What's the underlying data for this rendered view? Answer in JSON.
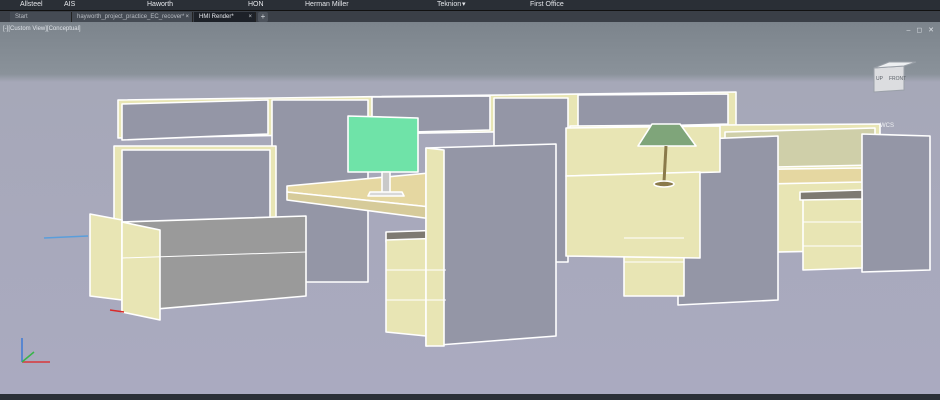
{
  "toolbar": {
    "items": [
      "Allsteel",
      "AIS",
      "Haworth",
      "HON",
      "Herman Miller",
      "Teknion",
      "First Office"
    ],
    "teknion_chevron": "▾"
  },
  "tabs": {
    "start": "Start",
    "file": "hayworth_project_practice_EC_recover*",
    "active": "HMI Render*",
    "close_glyph": "×",
    "add_glyph": "+"
  },
  "viewport": {
    "label": "[-][Custom View][Conceptual]",
    "controls": "– ◻ ✕",
    "viewcube": {
      "top": "UP",
      "front": "FRONT"
    },
    "wcs_label": "WCS"
  },
  "colors": {
    "panel_fill": "#e8e5b4",
    "fabric_panel": "#9496a6",
    "monitor_screen": "#6fe3a8",
    "desk_top": "#e5d7a1",
    "edge": "#ffffff"
  }
}
